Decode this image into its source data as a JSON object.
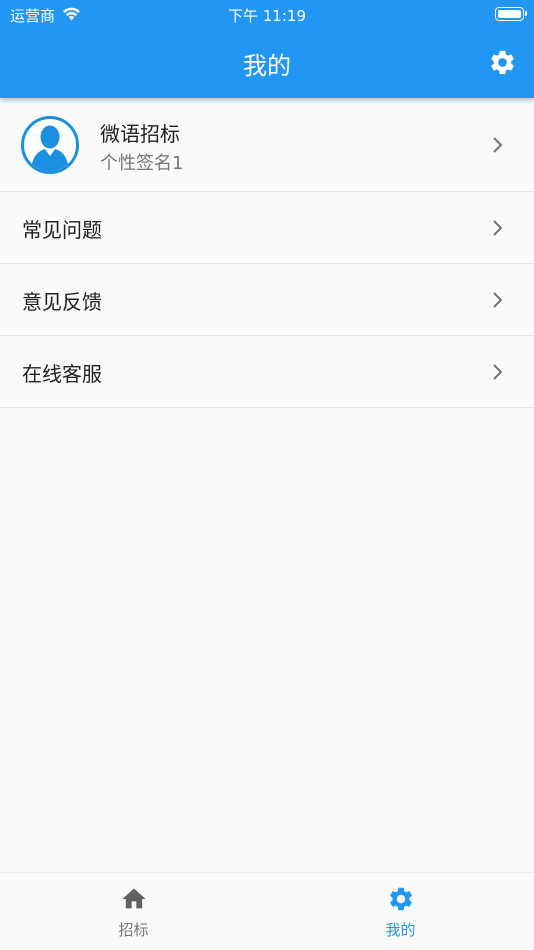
{
  "status_bar": {
    "carrier": "运营商",
    "time": "下午 11:19",
    "wifi_icon": "wifi-icon",
    "battery_icon": "battery-icon"
  },
  "header": {
    "title": "我的",
    "settings_icon": "gear-icon",
    "background_color": "#2196f3"
  },
  "profile": {
    "name": "微语招标",
    "signature": "个性签名1",
    "avatar_icon": "person-avatar-icon"
  },
  "menu": {
    "items": [
      {
        "label": "常见问题",
        "icon": "chevron-right-icon"
      },
      {
        "label": "意见反馈",
        "icon": "chevron-right-icon"
      },
      {
        "label": "在线客服",
        "icon": "chevron-right-icon"
      }
    ]
  },
  "bottom_nav": {
    "items": [
      {
        "label": "招标",
        "icon": "home-icon",
        "active": false
      },
      {
        "label": "我的",
        "icon": "gear-icon",
        "active": true
      }
    ],
    "active_color": "#2196f3",
    "inactive_color": "#757575"
  }
}
